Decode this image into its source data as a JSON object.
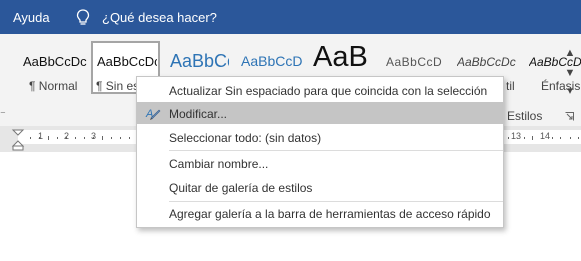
{
  "topbar": {
    "help_tab": "Ayuda",
    "tell_me": "¿Qué desea hacer?"
  },
  "styles_gallery": {
    "items": [
      {
        "preview": "AaBbCcDc",
        "name": "¶ Normal"
      },
      {
        "preview": "AaBbCcDc",
        "name": "¶ Sin espaciado"
      },
      {
        "preview": "AaBbCc",
        "name": ""
      },
      {
        "preview": "AaBbCcD",
        "name": ""
      },
      {
        "preview": "AaB",
        "name": ""
      },
      {
        "preview": "AaBbCcD",
        "name": ""
      },
      {
        "preview": "AaBbCcDc",
        "name": "til"
      },
      {
        "preview": "AaBbCcDc",
        "name": "Énfasis"
      }
    ],
    "group_label": "Estilos",
    "scroll_up": "▲",
    "scroll_down": "▼",
    "more": "▾"
  },
  "ruler": {
    "numbers": [
      "1",
      "2",
      "3",
      "13",
      "14"
    ]
  },
  "context_menu": {
    "items": [
      {
        "label": "Actualizar Sin espaciado para que coincida con la selección",
        "icon": "",
        "highlighted": false
      },
      {
        "label": "Modificar...",
        "icon": "modify-style-icon",
        "highlighted": true
      },
      {
        "label": "Seleccionar todo: (sin datos)",
        "icon": "",
        "highlighted": false
      },
      {
        "label": "Cambiar nombre...",
        "icon": "",
        "highlighted": false
      },
      {
        "label": "Quitar de galería de estilos",
        "icon": "",
        "highlighted": false
      },
      {
        "label": "Agregar galería a la barra de herramientas de acceso rápido",
        "icon": "",
        "highlighted": false
      }
    ]
  },
  "colors": {
    "title_bar": "#2b579a",
    "menu_highlight": "#c5c5c5",
    "heading_blue": "#2e74b5"
  }
}
